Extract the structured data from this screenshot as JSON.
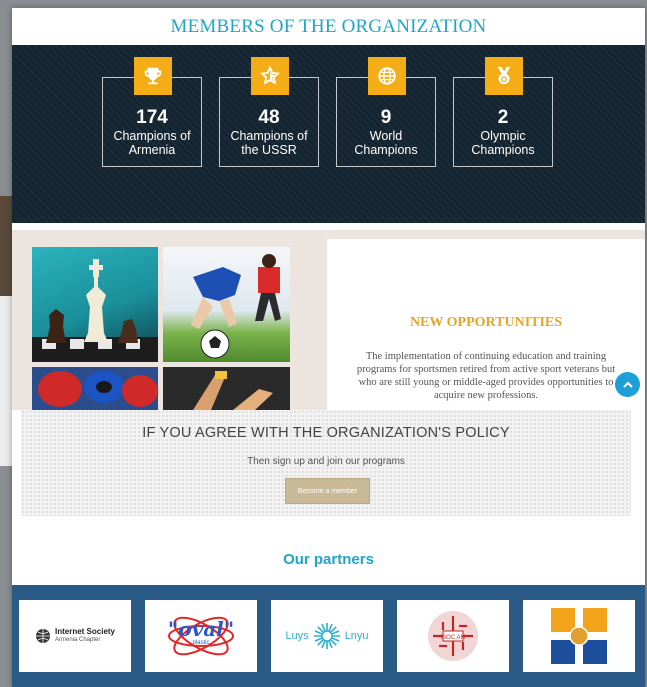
{
  "members": {
    "title": "MEMBERS OF THE ORGANIZATION",
    "stats": [
      {
        "number": "174",
        "label_line1": "Champions of",
        "label_line2": "Armenia",
        "icon": "trophy-icon"
      },
      {
        "number": "48",
        "label_line1": "Champions of",
        "label_line2": "the USSR",
        "icon": "star-icon"
      },
      {
        "number": "9",
        "label_line1": "World",
        "label_line2": "Champions",
        "icon": "globe-icon"
      },
      {
        "number": "2",
        "label_line1": "Olympic",
        "label_line2": "Champions",
        "icon": "medal-icon"
      }
    ],
    "accent": "#f4ad16"
  },
  "opportunities": {
    "title": "NEW OPPORTUNITIES",
    "body_line1": "The implementation of continuing education and training",
    "body_line2": "programs for sportsmen retired from active sport veterans but",
    "body_line3": "who are still young or middle-aged provides opportunities to",
    "body_line4": "acquire new professions."
  },
  "policy": {
    "title": "IF YOU AGREE WITH THE ORGANIZATION'S POLICY",
    "subtitle": "Then sign up and join our programs",
    "button": "Become a member"
  },
  "partners": {
    "title": "Our partners",
    "logos": [
      {
        "line1": "Internet Society",
        "line2": "Armenia Chapter"
      },
      {
        "text": "\"oval\"",
        "sub": "plastic"
      },
      {
        "left": "Luys",
        "right": "Lnyu"
      },
      {
        "text": "ISOC AM"
      },
      {
        "icon": "cross-emblem-icon"
      }
    ]
  },
  "colors": {
    "title_blue": "#1ea6c9",
    "dark_navy": "#142431",
    "partners_bg": "#2a5a86",
    "button_tan": "#c8b998"
  }
}
